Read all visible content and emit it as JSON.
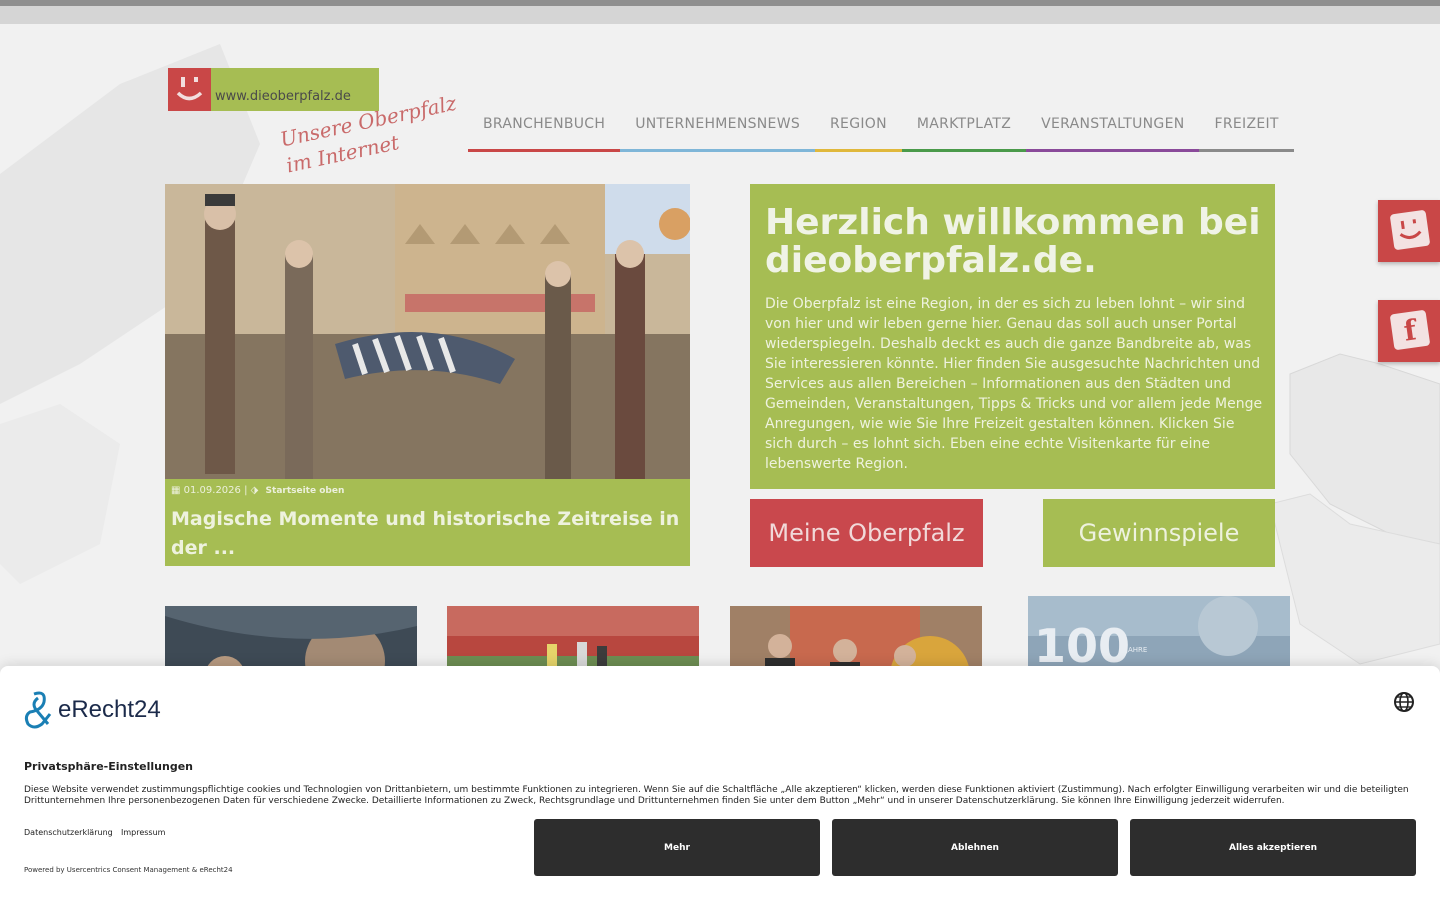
{
  "logo": {
    "url_text": "www.dieoberpfalz.de",
    "tagline_line1": "Unsere Oberpfalz",
    "tagline_line2": "im Internet"
  },
  "nav": {
    "items": [
      {
        "label": "BRANCHENBUCH",
        "color": "#c94747"
      },
      {
        "label": "UNTERNEHMENSNEWS",
        "color": "#7fb6d8"
      },
      {
        "label": "REGION",
        "color": "#e0b83c"
      },
      {
        "label": "MARKTPLATZ",
        "color": "#4a9a4a"
      },
      {
        "label": "VERANSTALTUNGEN",
        "color": "#8a4a9a"
      },
      {
        "label": "FREIZEIT",
        "color": "#8a8a8a"
      }
    ]
  },
  "hero": {
    "date": "01.09.2026",
    "category": "Startseite oben",
    "title": "Magische Momente und historische Zeitreise in der ..."
  },
  "welcome": {
    "title": "Herzlich willkommen bei dieoberpfalz.de.",
    "text": "Die Oberpfalz ist eine Region, in der es sich zu leben lohnt – wir sind von hier und wir leben gerne hier. Genau das soll auch unser Portal wiederspiegeln. Deshalb deckt es auch die ganze Bandbreite ab, was Sie interessieren könnte. Hier finden Sie ausgesuchte Nachrichten und Services aus allen Bereichen – Informationen aus den Städten und Gemeinden, Veranstaltungen, Tipps & Tricks und vor allem jede Menge Anregungen, wie wie Sie Ihre Freizeit gestalten können. Klicken Sie sich durch – es lohnt sich. Eben eine echte Visitenkarte für eine lebenswerte Region."
  },
  "buttons": {
    "meine": "Meine Oberpfalz",
    "gewinn": "Gewinnspiele"
  },
  "side_tabs": {
    "facebook_letter": "f"
  },
  "thumb4": {
    "badge": "100",
    "sub": "JAHRE"
  },
  "consent": {
    "brand": "eRecht24",
    "title": "Privatsphäre-Einstellungen",
    "text": "Diese Website verwendet zustimmungspflichtige cookies und Technologien von Drittanbietern, um bestimmte Funktionen zu integrieren. Wenn Sie auf die Schaltfläche „Alle akzeptieren“ klicken, werden diese Funktionen aktiviert (Zustimmung). Nach erfolgter Einwilligung verarbeiten wir und die beteiligten Drittunternehmen Ihre personenbezogenen Daten für verschiedene Zwecke. Detaillierte Informationen zu Zweck, Rechtsgrundlage und Drittunternehmen finden Sie unter dem Button „Mehr“ und in unserer Datenschutzerklärung. Sie können Ihre Einwilligung jederzeit widerrufen.",
    "link_privacy": "Datenschutzerklärung",
    "link_imprint": "Impressum",
    "powered": "Powered by Usercentrics Consent Management & eRecht24",
    "btn_more": "Mehr",
    "btn_decline": "Ablehnen",
    "btn_accept": "Alles akzeptieren"
  }
}
